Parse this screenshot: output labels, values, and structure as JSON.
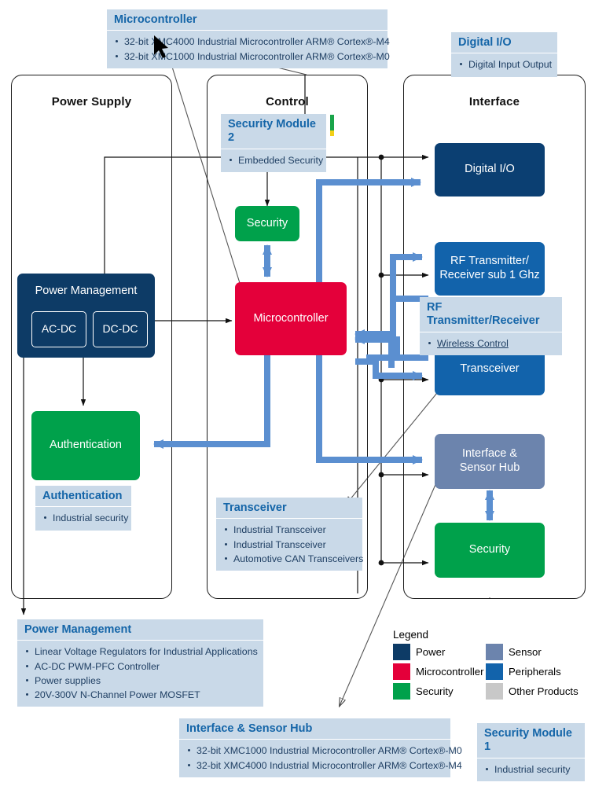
{
  "groups": [
    {
      "id": "power-supply",
      "title": "Power Supply"
    },
    {
      "id": "control",
      "title": "Control"
    },
    {
      "id": "interface",
      "title": "Interface"
    }
  ],
  "blocks": {
    "power_management": {
      "label": "Power Management",
      "sub": [
        "AC-DC",
        "DC-DC"
      ]
    },
    "authentication": {
      "label": "Authentication"
    },
    "security_control": {
      "label": "Security"
    },
    "microcontroller": {
      "label": "Microcontroller"
    },
    "digital_io": {
      "label": "Digital I/O"
    },
    "rf_transceiver": {
      "line1": "RF Transmitter/",
      "line2": "Receiver sub 1 Ghz"
    },
    "transceiver": {
      "label": "Transceiver"
    },
    "sensor_hub": {
      "line1": "Interface &",
      "line2": "Sensor Hub"
    },
    "security_interface": {
      "label": "Security"
    }
  },
  "callouts": {
    "microcontroller": {
      "title": "Microcontroller",
      "items": [
        "32-bit XMC4000 Industrial Microcontroller ARM® Cortex®-M4",
        "32-bit XMC1000 Industrial Microcontroller ARM® Cortex®-M0"
      ]
    },
    "digital_io": {
      "title": "Digital I/O",
      "items": [
        "Digital Input Output"
      ]
    },
    "security_module_2": {
      "title": "Security Module 2",
      "items": [
        "Embedded Security"
      ]
    },
    "rf_transmitter_receiver": {
      "title": "RF Transmitter/Receiver",
      "items": [
        "Wireless Control"
      ]
    },
    "authentication": {
      "title": "Authentication",
      "items": [
        "Industrial security"
      ]
    },
    "transceiver": {
      "title": "Transceiver",
      "items": [
        "Industrial Transceiver",
        "Industrial Transceiver",
        "Automotive CAN Transceivers"
      ]
    },
    "power_management": {
      "title": "Power Management",
      "items": [
        "Linear Voltage Regulators for Industrial Applications",
        "AC-DC PWM-PFC Controller",
        "Power supplies",
        "20V-300V N-Channel Power MOSFET"
      ]
    },
    "interface_sensor_hub": {
      "title": "Interface & Sensor Hub",
      "items": [
        "32-bit XMC1000 Industrial Microcontroller ARM® Cortex®-M0",
        "32-bit XMC4000 Industrial Microcontroller ARM® Cortex®-M4"
      ]
    },
    "security_module_1": {
      "title": "Security Module 1",
      "items": [
        "Industrial security"
      ]
    }
  },
  "legend": {
    "title": "Legend",
    "items": [
      {
        "label": "Power",
        "color": "#0d3b66"
      },
      {
        "label": "Microcontroller",
        "color": "#e4003a"
      },
      {
        "label": "Security",
        "color": "#00a14b"
      },
      {
        "label": "Sensor",
        "color": "#6c84ad"
      },
      {
        "label": "Peripherals",
        "color": "#1263ab"
      },
      {
        "label": "Other Products",
        "color": "#c8c8c8"
      }
    ]
  },
  "colors": {
    "power": "#0d3b66",
    "microcontroller": "#e4003a",
    "security": "#00a14b",
    "sensor": "#6c84ad",
    "peripherals": "#1263ab",
    "other": "#c8c8c8",
    "blue_arrow": "#5b8fd0",
    "callout_bg": "#c9d9e8",
    "callout_title": "#1465a8"
  }
}
